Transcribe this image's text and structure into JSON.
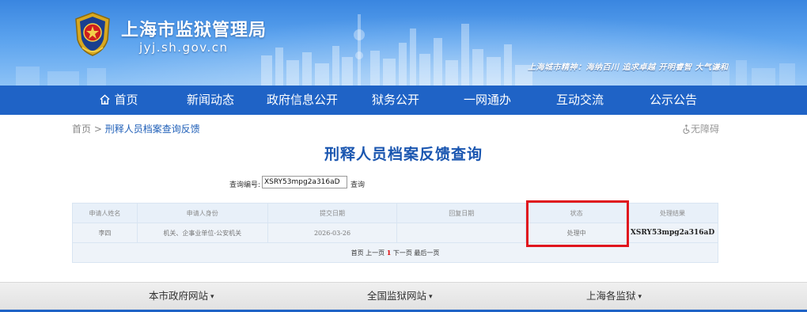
{
  "header": {
    "site_title": "上海市监狱管理局",
    "site_domain": "jyj.sh.gov.cn",
    "city_spirit": "上海城市精神：海纳百川 追求卓越 开明睿智 大气谦和"
  },
  "nav": {
    "items": [
      {
        "label": "首页",
        "icon": "home-icon"
      },
      {
        "label": "新闻动态"
      },
      {
        "label": "政府信息公开"
      },
      {
        "label": "狱务公开"
      },
      {
        "label": "一网通办"
      },
      {
        "label": "互动交流"
      },
      {
        "label": "公示公告"
      }
    ]
  },
  "breadcrumb": {
    "home": "首页",
    "separator": ">",
    "current": "刑释人员档案查询反馈"
  },
  "accessibility": {
    "label": "无障碍",
    "icon": "wheelchair-icon"
  },
  "page_title": "刑释人员档案反馈查询",
  "query": {
    "label": "查询编号:",
    "value": "XSRY53mpg2a316aD",
    "button": "查询"
  },
  "table": {
    "headers": [
      "申请人姓名",
      "申请人身份",
      "提交日期",
      "回复日期",
      "状态",
      "处理结果"
    ],
    "rows": [
      [
        "李四",
        "机关、企事业单位-公安机关",
        "2026-03-26",
        "",
        "处理中",
        "XSRY53mpg2a316aD"
      ]
    ],
    "pager": {
      "first": "首页",
      "prev": "上一页",
      "current": "1",
      "next": "下一页",
      "last": "最后一页"
    }
  },
  "footer": {
    "items": [
      "本市政府网站",
      "全国监狱网站",
      "上海各监狱"
    ],
    "caret": "▾"
  },
  "colors": {
    "nav_bg": "#1f63c6",
    "title_blue": "#1a56b0",
    "highlight_red": "#e0161e"
  }
}
